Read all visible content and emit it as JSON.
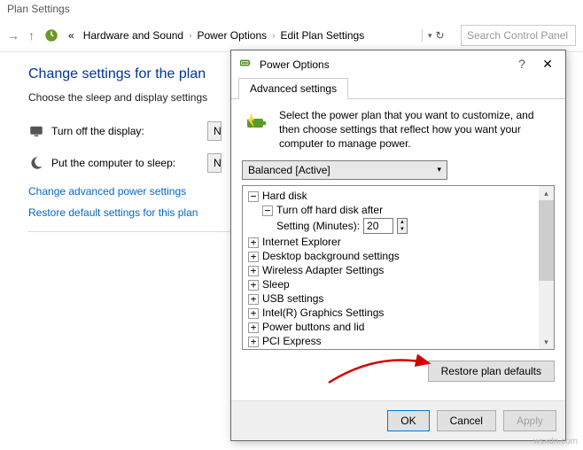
{
  "window": {
    "title": "Plan Settings",
    "breadcrumb": {
      "item1": "Hardware and Sound",
      "item2": "Power Options",
      "item3": "Edit Plan Settings"
    },
    "search_placeholder": "Search Control Panel"
  },
  "page": {
    "heading": "Change settings for the plan",
    "sub": "Choose the sleep and display settings",
    "display_label": "Turn off the display:",
    "display_value": "N",
    "sleep_label": "Put the computer to sleep:",
    "sleep_value": "N",
    "link_advanced": "Change advanced power settings",
    "link_restore": "Restore default settings for this plan"
  },
  "dialog": {
    "title": "Power Options",
    "tab": "Advanced settings",
    "intro": "Select the power plan that you want to customize, and then choose settings that reflect how you want your computer to manage power.",
    "plan": "Balanced [Active]",
    "tree": {
      "n0": "Hard disk",
      "n0_0": "Turn off hard disk after",
      "n0_0_label": "Setting (Minutes):",
      "n0_0_value": "20",
      "n1": "Internet Explorer",
      "n2": "Desktop background settings",
      "n3": "Wireless Adapter Settings",
      "n4": "Sleep",
      "n5": "USB settings",
      "n6": "Intel(R) Graphics Settings",
      "n7": "Power buttons and lid",
      "n8": "PCI Express"
    },
    "restore_btn": "Restore plan defaults",
    "ok": "OK",
    "cancel": "Cancel",
    "apply": "Apply"
  },
  "watermark": "wsxdn.com"
}
